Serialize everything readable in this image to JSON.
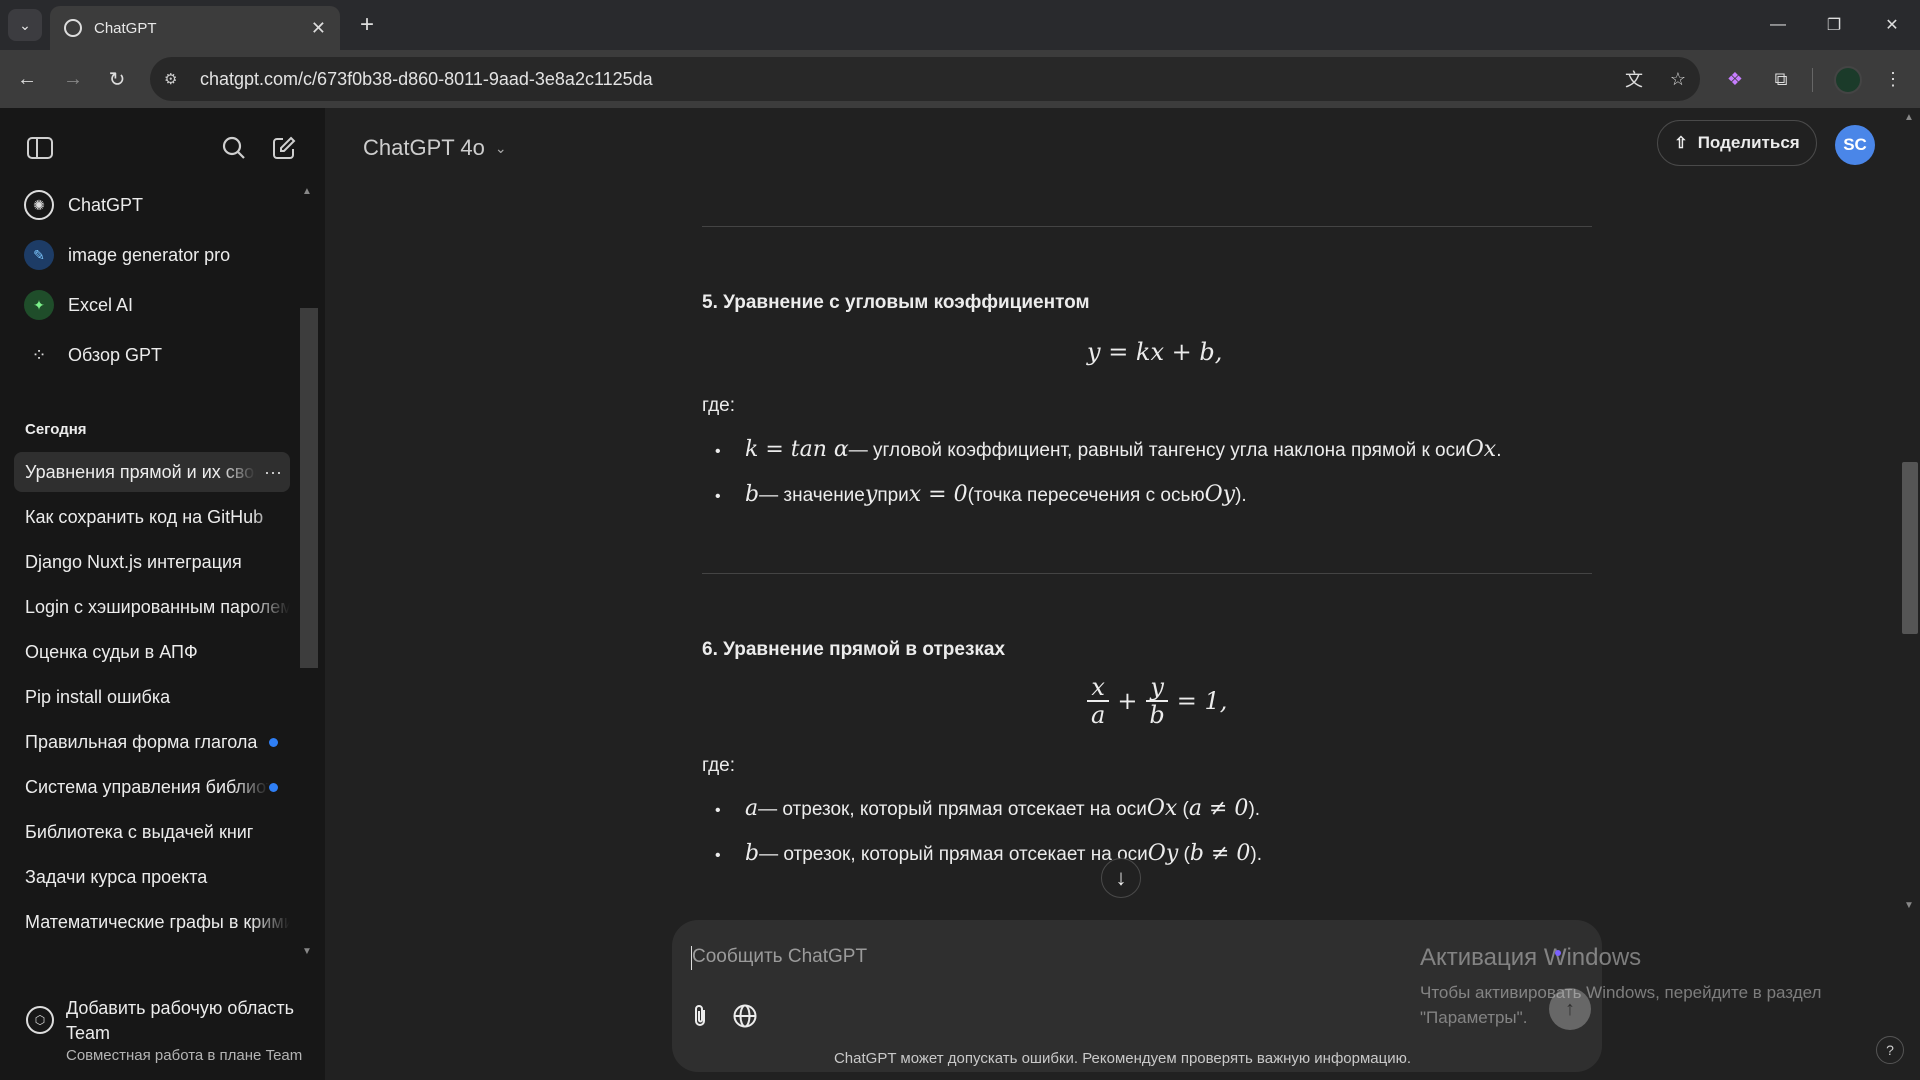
{
  "browser": {
    "tab_title": "ChatGPT",
    "url": "chatgpt.com/c/673f0b38-d860-8011-9aad-3e8a2c1125da"
  },
  "sidebar": {
    "gpts": [
      {
        "label": "ChatGPT",
        "icon": "openai-logo-icon"
      },
      {
        "label": "image generator pro",
        "icon": "image-generator-icon"
      },
      {
        "label": "Excel AI",
        "icon": "excel-ai-icon"
      },
      {
        "label": "Обзор GPT",
        "icon": "grid-icon"
      }
    ],
    "section_today": "Сегодня",
    "chats": [
      {
        "label": "Уравнения прямой и их свойства",
        "active": true
      },
      {
        "label": "Как сохранить код на GitHub"
      },
      {
        "label": "Django Nuxt.js интеграция"
      },
      {
        "label": "Login с хэшированным паролем"
      },
      {
        "label": "Оценка судьи в АПФ"
      },
      {
        "label": "Pip install ошибка"
      },
      {
        "label": "Правильная форма глагола",
        "unread": true
      },
      {
        "label": "Система управления библиотекой",
        "unread": true
      },
      {
        "label": "Библиотека с выдачей книг"
      },
      {
        "label": "Задачи курса проекта"
      },
      {
        "label": "Математические графы в криминалистике"
      }
    ],
    "upgrade": {
      "title": "Добавить рабочую область Team",
      "subtitle": "Совместная работа в плане Team"
    }
  },
  "header": {
    "model": "ChatGPT 4o",
    "share_label": "Поделиться",
    "avatar_initials": "SC"
  },
  "content": {
    "s5_heading": "5. Уравнение с угловым коэффициентом",
    "s5_formula": "y = kx + b,",
    "where": "где:",
    "s5_b1_math": "k = tan α",
    "s5_b1_text": " — угловой коэффициент, равный тангенсу угла наклона прямой к оси ",
    "s5_b1_axis": "Ox",
    "s5_b2_math": "b",
    "s5_b2_text1": " — значение ",
    "s5_b2_y": "y",
    "s5_b2_text2": " при ",
    "s5_b2_x0": "x = 0",
    "s5_b2_text3": " (точка пересечения с осью ",
    "s5_b2_axis": "Oy",
    "s5_b2_text4": ").",
    "s6_heading": "6. Уравнение прямой в отрезках",
    "s6_x": "x",
    "s6_a": "a",
    "s6_y": "y",
    "s6_b": "b",
    "s6_rest": "= 1,",
    "s6_b1_math": "a",
    "s6_b1_text": " — отрезок, который прямая отсекает на оси ",
    "s6_b1_axis": "Ox",
    "s6_b1_cond": "a ≠ 0",
    "s6_b2_math": "b",
    "s6_b2_text": " — отрезок, который прямая отсекает на оси ",
    "s6_b2_axis": "Oy",
    "s6_b2_cond": "b ≠ 0"
  },
  "composer": {
    "placeholder": "Сообщить ChatGPT",
    "disclaimer": "ChatGPT может допускать ошибки. Рекомендуем проверять важную информацию."
  },
  "watermark": {
    "title": "Активация Windows",
    "text": "Чтобы активировать Windows, перейдите в раздел \"Параметры\"."
  },
  "colors": {
    "page_bg": "#212121",
    "sidebar_bg": "#171717",
    "avatar": "#4a86e8",
    "unread_dot": "#2f7ff5"
  }
}
